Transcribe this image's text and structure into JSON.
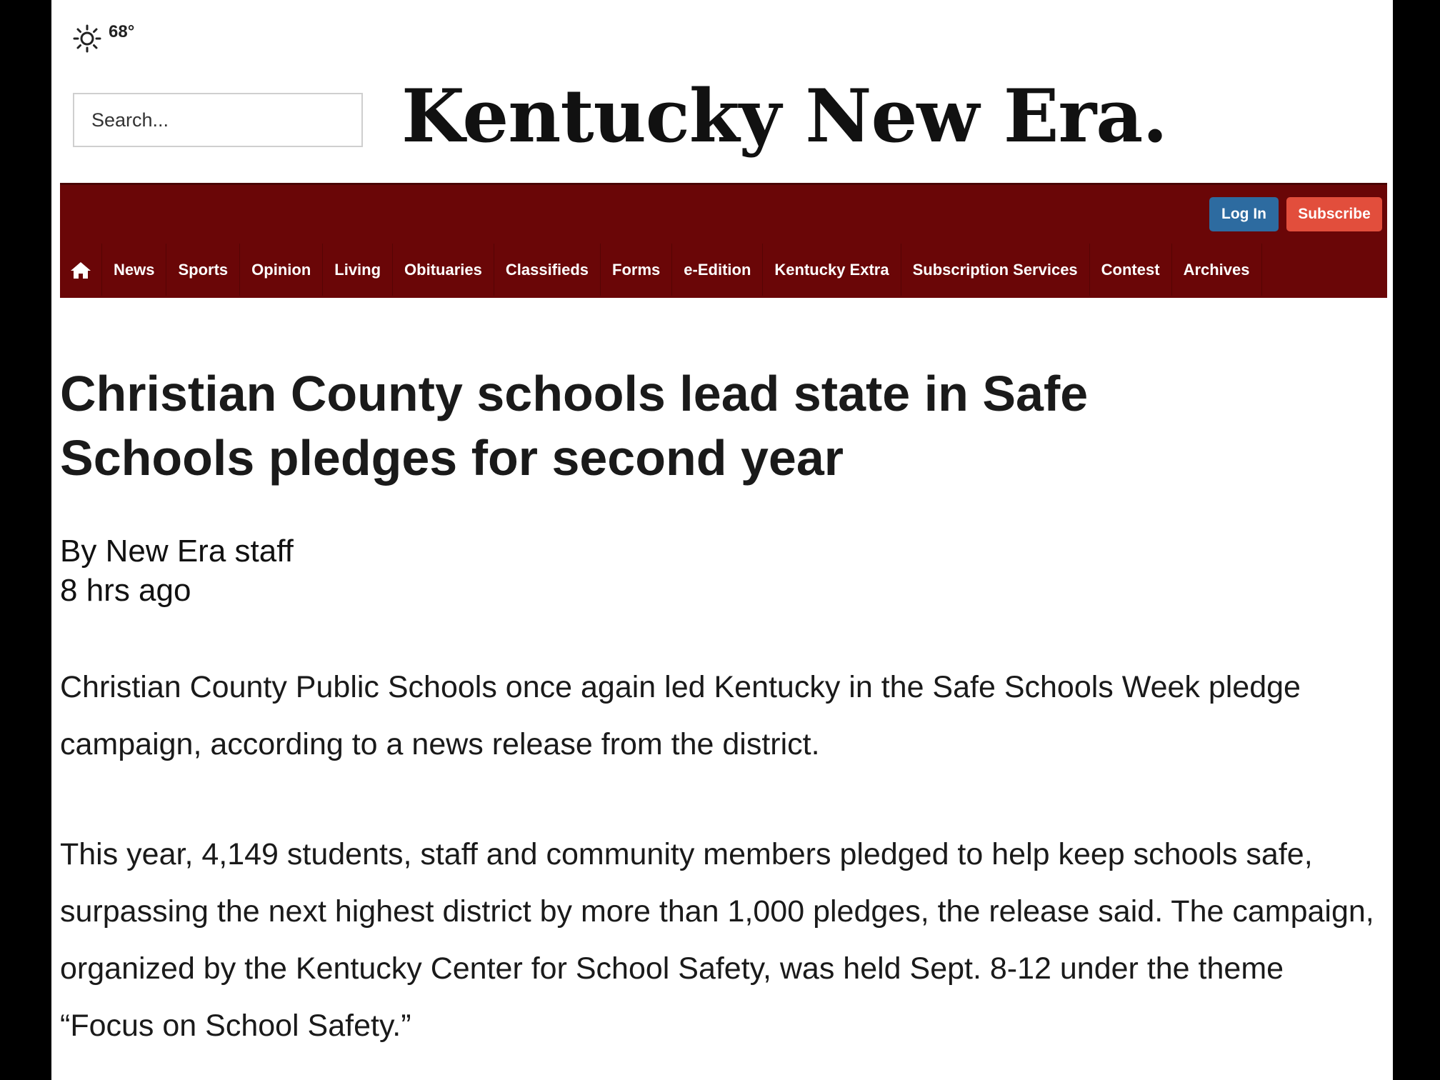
{
  "weather": {
    "icon": "sun-icon",
    "temperature": "68°"
  },
  "search": {
    "placeholder": "Search..."
  },
  "masthead": {
    "title": "Kentucky New Era."
  },
  "auth": {
    "login_label": "Log In",
    "subscribe_label": "Subscribe"
  },
  "nav": {
    "home_icon": "home-icon",
    "items": [
      "News",
      "Sports",
      "Opinion",
      "Living",
      "Obituaries",
      "Classifieds",
      "Forms",
      "e-Edition",
      "Kentucky Extra",
      "Subscription Services",
      "Contest",
      "Archives"
    ]
  },
  "article": {
    "headline": "Christian County schools lead state in Safe Schools pledges for second year",
    "byline": "By New Era staff",
    "timestamp": "8 hrs ago",
    "paragraphs": [
      "Christian County Public Schools once again led Kentucky in the Safe Schools Week pledge campaign, according to a news release from the district.",
      "This year, 4,149 students, staff and community members pledged to help keep schools safe, surpassing the next highest district by more than 1,000 pledges, the release said. The campaign, organized by the Kentucky Center for School Safety, was held Sept. 8-12 under the theme “Focus on School Safety.”"
    ]
  },
  "colors": {
    "navbar": "#6a0607",
    "login": "#2d6ba0",
    "subscribe": "#e24e3c"
  }
}
